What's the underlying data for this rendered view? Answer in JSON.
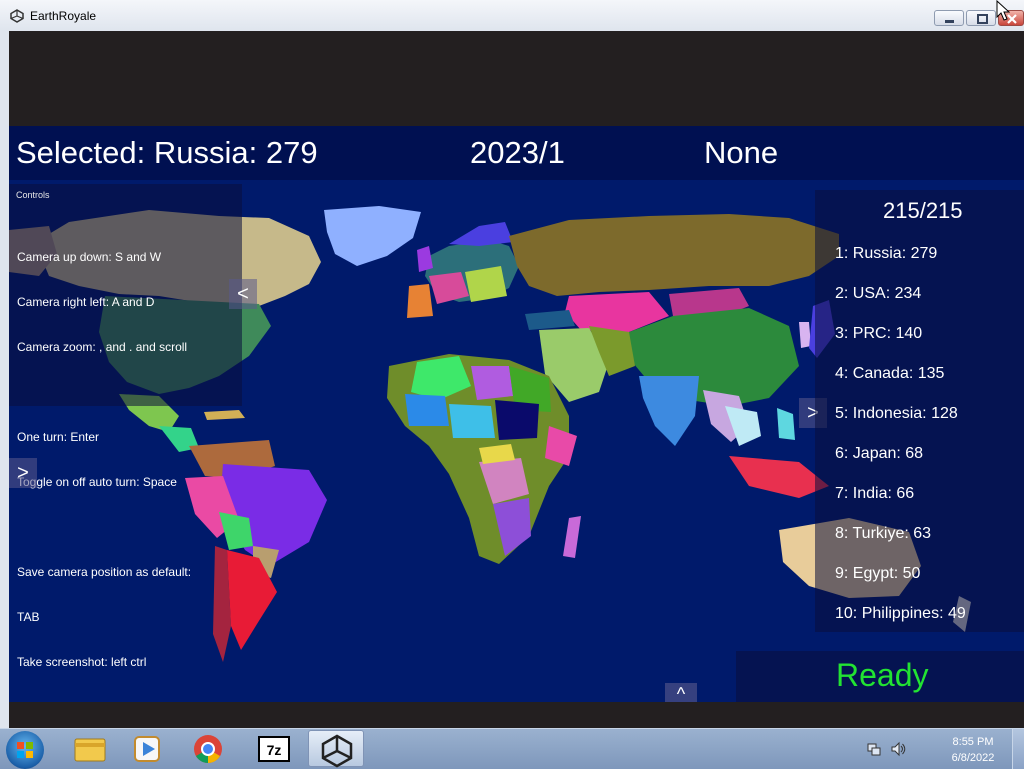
{
  "window": {
    "title": "EarthRoyale"
  },
  "hud": {
    "selected": "Selected: Russia: 279",
    "date": "2023/1",
    "status": "None"
  },
  "controls": {
    "title": "Controls",
    "lines": [
      "Camera up down: S and W",
      "Camera right left: A and D",
      "Camera zoom: , and . and scroll",
      "",
      "One turn: Enter",
      "Toggle on off auto turn: Space",
      "",
      "Save camera position as default:",
      "TAB",
      "Take screenshot: left ctrl"
    ]
  },
  "nav": {
    "left_panel_arrow": "<",
    "right_panel_arrow": ">",
    "left_edge_arrow": ">",
    "up_arrow": "^"
  },
  "ranking": {
    "count": "215/215",
    "items": [
      "1: Russia: 279",
      "2: USA: 234",
      "3: PRC: 140",
      "4: Canada: 135",
      "5: Indonesia: 128",
      "6: Japan: 68",
      "7: India: 66",
      "8: Turkiye: 63",
      "9: Egypt: 50",
      "10: Philippines: 49"
    ]
  },
  "ready": {
    "label": "Ready",
    "color": "#22e332"
  },
  "colors": {
    "ocean": "#001a6b",
    "panel": "#0a0f3c"
  },
  "taskbar": {
    "apps": [
      "start-orb",
      "file-explorer-icon",
      "media-player-icon",
      "chrome-icon",
      "7zip-icon",
      "unity-icon"
    ],
    "time": "8:55 PM",
    "date": "6/8/2022"
  }
}
